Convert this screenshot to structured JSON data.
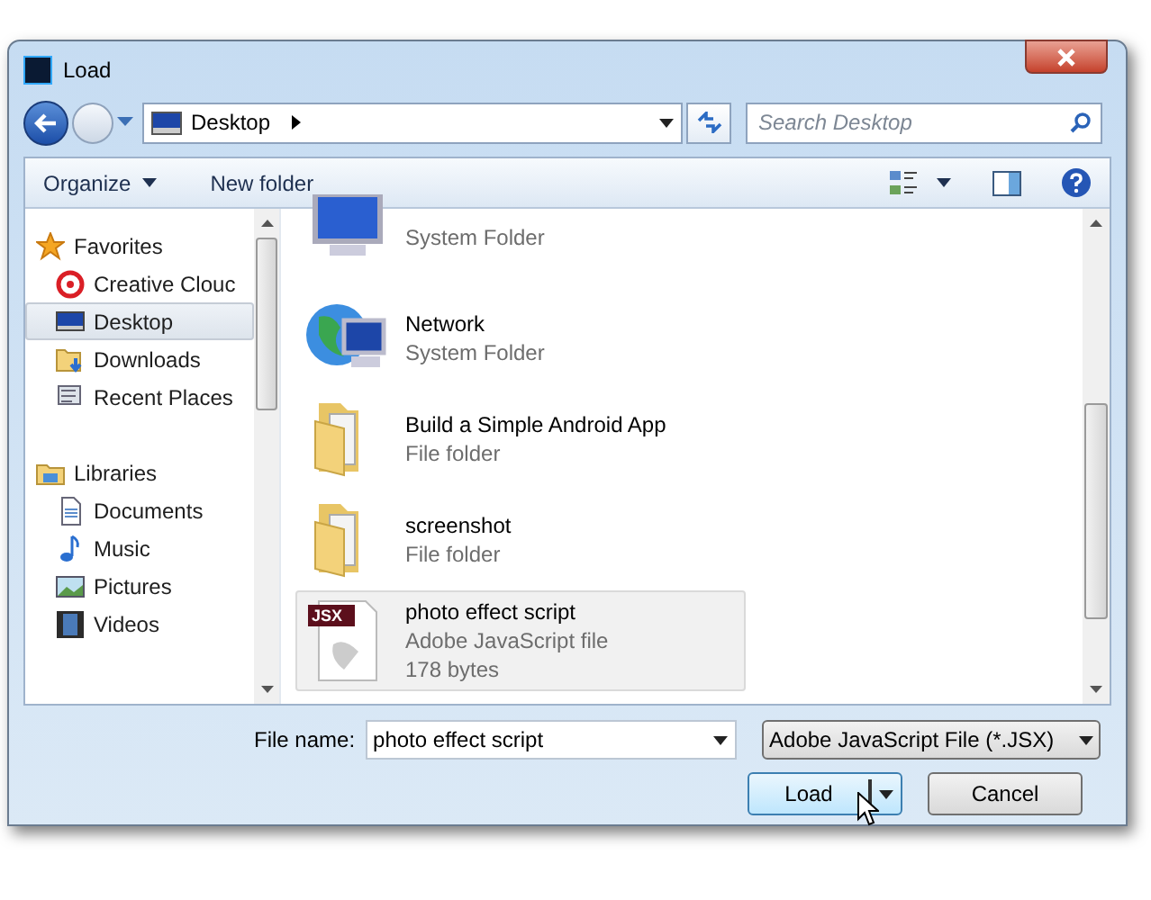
{
  "window": {
    "title": "Load"
  },
  "address_bar": {
    "location": "Desktop"
  },
  "search": {
    "placeholder": "Search Desktop"
  },
  "toolbar": {
    "organize": "Organize",
    "new_folder": "New folder"
  },
  "sidebar": {
    "groups": [
      {
        "label": "Favorites",
        "kind": "favorites",
        "children": [
          {
            "label": "Creative Clouc",
            "kind": "cloud",
            "selected": false
          },
          {
            "label": "Desktop",
            "kind": "desktop",
            "selected": true
          },
          {
            "label": "Downloads",
            "kind": "downloads",
            "selected": false
          },
          {
            "label": "Recent Places",
            "kind": "recent",
            "selected": false
          }
        ]
      },
      {
        "label": "Libraries",
        "kind": "libraries",
        "children": [
          {
            "label": "Documents",
            "kind": "documents",
            "selected": false
          },
          {
            "label": "Music",
            "kind": "music",
            "selected": false
          },
          {
            "label": "Pictures",
            "kind": "pictures",
            "selected": false
          },
          {
            "label": "Videos",
            "kind": "videos",
            "selected": false
          }
        ]
      }
    ]
  },
  "files": [
    {
      "kind": "computer",
      "details": [
        "System Folder"
      ],
      "selected": false
    },
    {
      "kind": "network",
      "name": "Network",
      "details": [
        "System Folder"
      ],
      "selected": false
    },
    {
      "kind": "folder",
      "name": "Build a Simple Android App",
      "details": [
        "File folder"
      ],
      "selected": false
    },
    {
      "kind": "folder",
      "name": "screenshot",
      "details": [
        "File folder"
      ],
      "selected": false
    },
    {
      "kind": "jsx",
      "name": "photo effect script",
      "badge": "JSX",
      "details": [
        "Adobe JavaScript file",
        "178 bytes"
      ],
      "selected": true
    }
  ],
  "footer": {
    "file_name_label": "File name:",
    "file_name": "photo effect script",
    "file_type": "Adobe JavaScript File (*.JSX)",
    "load": "Load",
    "cancel": "Cancel"
  }
}
